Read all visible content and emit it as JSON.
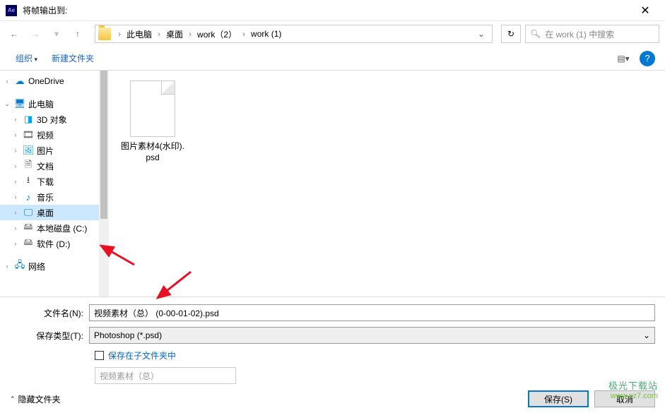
{
  "window": {
    "title": "将帧输出到:"
  },
  "breadcrumb": {
    "items": [
      "此电脑",
      "桌面",
      "work（2）",
      "work (1)"
    ]
  },
  "search": {
    "placeholder": "在 work (1) 中搜索"
  },
  "toolbar": {
    "organize": "组织",
    "newfolder": "新建文件夹"
  },
  "tree": {
    "onedrive": "OneDrive",
    "thispc": "此电脑",
    "obj3d": "3D 对象",
    "videos": "视频",
    "pictures": "图片",
    "documents": "文档",
    "downloads": "下载",
    "music": "音乐",
    "desktop": "桌面",
    "diskc": "本地磁盘 (C:)",
    "diskd": "软件 (D:)",
    "network": "网络"
  },
  "files": [
    {
      "name": "图片素材4(水印).psd"
    }
  ],
  "form": {
    "filename_label": "文件名(N):",
    "filename_value": "视频素材（总） (0-00-01-02).psd",
    "savetype_label": "保存类型(T):",
    "savetype_value": "Photoshop (*.psd)",
    "subsave_label": "保存在子文件夹中",
    "subsave_value": "视频素材（总）"
  },
  "footer": {
    "hide": "隐藏文件夹",
    "save": "保存(S)",
    "cancel": "取消"
  },
  "watermark": {
    "line1": "极光下载站",
    "line2": "www.xz7.com"
  }
}
